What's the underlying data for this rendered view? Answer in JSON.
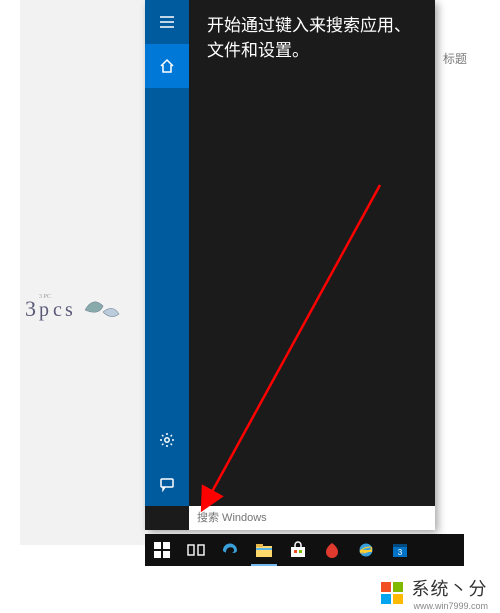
{
  "background": {
    "right_label": "标题",
    "watermark_text": "3pcs"
  },
  "search_panel": {
    "hint": "开始通过键入来搜索应用、文件和设置。",
    "rail": {
      "menu_icon": "hamburger-icon",
      "home_icon": "home-icon",
      "settings_icon": "gear-icon",
      "feedback_icon": "feedback-icon"
    },
    "search_placeholder": "搜索 Windows"
  },
  "taskbar": {
    "items": [
      {
        "name": "start-button",
        "icon": "windows-logo"
      },
      {
        "name": "task-view-button",
        "icon": "task-view"
      },
      {
        "name": "edge-button",
        "icon": "edge"
      },
      {
        "name": "file-explorer-button",
        "icon": "folder"
      },
      {
        "name": "store-button",
        "icon": "store"
      },
      {
        "name": "app-red-button",
        "icon": "red-app"
      },
      {
        "name": "ie-button",
        "icon": "ie"
      },
      {
        "name": "calendar-button",
        "icon": "calendar"
      }
    ]
  },
  "footer": {
    "brand": "系统丶分",
    "sub": "www.win7999.com"
  },
  "colors": {
    "rail": "#005a9e",
    "rail_active": "#0078d7",
    "panel": "#1b1b1b",
    "taskbar": "#101010",
    "arrow": "#ff0000"
  }
}
